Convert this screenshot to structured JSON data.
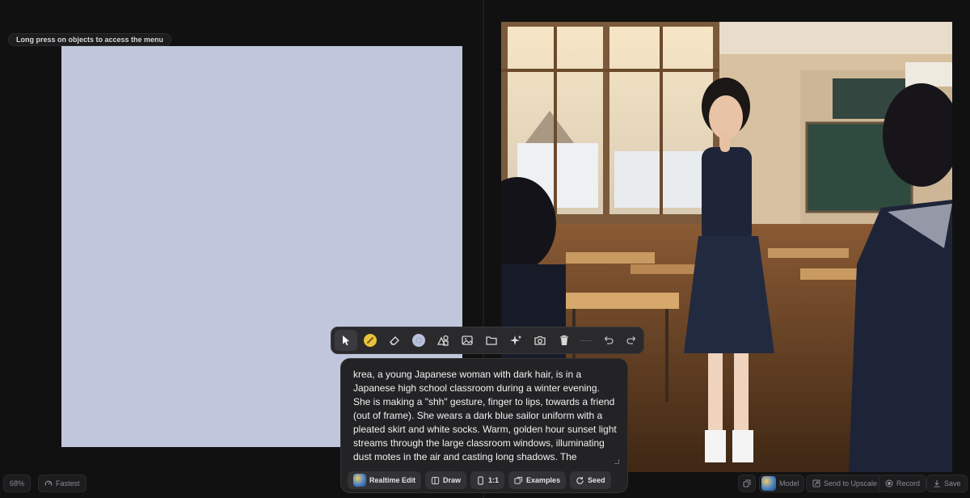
{
  "canvas_hint": "Long press on objects to access the menu",
  "colors": {
    "background": "#111111",
    "canvas_fill": "#c0c6dc",
    "panel": "#232325",
    "brush_yellow": "#e8c23a",
    "color_swatch": "#b8c0dc"
  },
  "toolbar": {
    "tools": [
      {
        "icon": "pointer-icon",
        "active": true
      },
      {
        "icon": "brush-icon",
        "active": false
      },
      {
        "icon": "eraser-icon",
        "active": false
      },
      {
        "icon": "color-swatch-icon",
        "active": false
      },
      {
        "icon": "shapes-icon",
        "active": false
      },
      {
        "icon": "image-icon",
        "active": false
      },
      {
        "icon": "folder-icon",
        "active": false
      },
      {
        "icon": "sparkles-icon",
        "active": false
      },
      {
        "icon": "camera-icon",
        "active": false
      },
      {
        "icon": "trash-icon",
        "active": false
      },
      {
        "icon": "undo-icon",
        "active": false
      },
      {
        "icon": "redo-icon",
        "active": false
      }
    ]
  },
  "prompt": {
    "text": "krea, a young Japanese woman with dark hair,  is in a Japanese high school classroom during a winter evening. She is making a \"shh\" gesture, finger to lips, towards a friend (out of frame). She wears a dark blue sailor uniform with a pleated skirt and white socks. Warm, golden hour sunset light streams through the large classroom windows, illuminating dust motes in the air and casting long shadows. The",
    "actions": {
      "realtime_edit": "Realtime Edit",
      "draw": "Draw",
      "aspect_ratio": "1:1",
      "examples": "Examples",
      "seed": "Seed"
    }
  },
  "bottom_bar": {
    "zoom": "68%",
    "speed": "Fastest",
    "model": "Model",
    "send_to_upscale": "Send to Upscale",
    "record": "Record",
    "save": "Save"
  }
}
